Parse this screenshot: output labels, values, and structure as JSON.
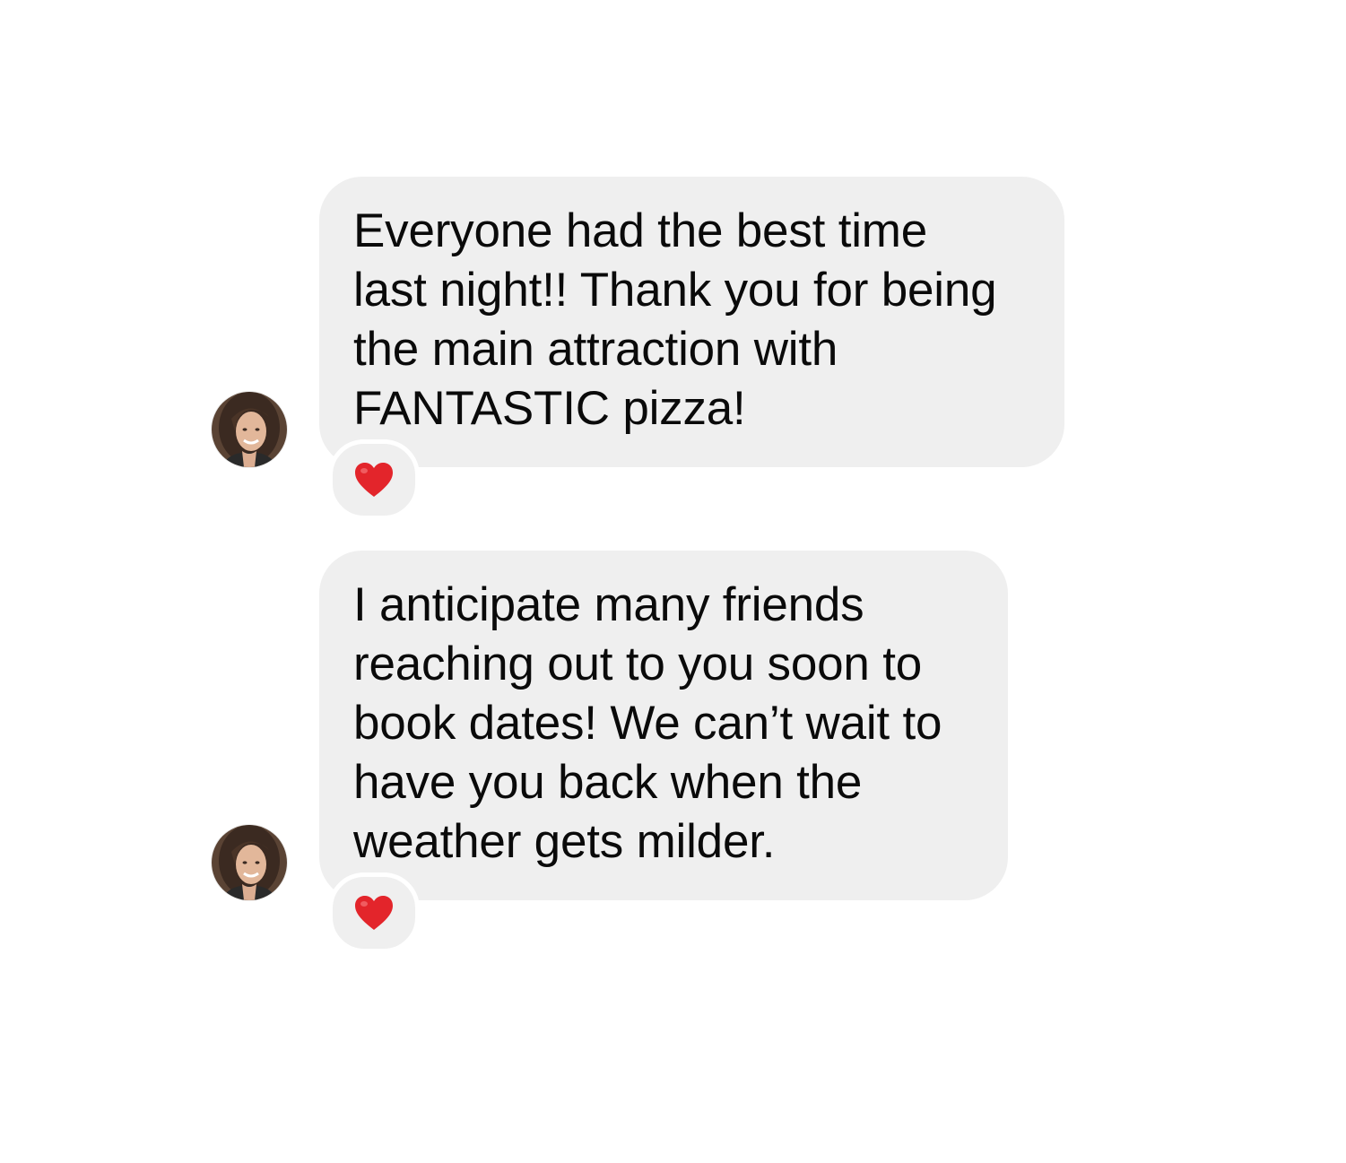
{
  "conversation": {
    "messages": [
      {
        "text": "Everyone had the best time\nlast night!! Thank you for being\nthe main attraction with\nFANTASTIC pizza!",
        "reaction": "heart-icon",
        "reaction_color": "#e3252b"
      },
      {
        "text": "I anticipate many friends\nreaching out to you soon to\nbook dates! We can’t wait to\nhave you back when the\nweather gets milder.",
        "reaction": "heart-icon",
        "reaction_color": "#e3252b"
      }
    ]
  },
  "colors": {
    "bubble_background": "#efefef",
    "page_background": "#ffffff",
    "text": "#0a0a0a"
  }
}
